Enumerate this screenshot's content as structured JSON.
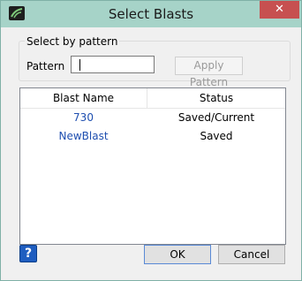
{
  "window": {
    "title": "Select Blasts",
    "close_glyph": "✕"
  },
  "pattern_group": {
    "legend": "Select by pattern",
    "label": "Pattern",
    "input_value": "",
    "apply_label": "Apply Pattern"
  },
  "table": {
    "columns": [
      "Blast Name",
      "Status"
    ],
    "rows": [
      {
        "name": "730",
        "status": "Saved/Current"
      },
      {
        "name": "NewBlast",
        "status": "Saved"
      }
    ]
  },
  "footer": {
    "help_glyph": "?",
    "ok_label": "OK",
    "cancel_label": "Cancel"
  },
  "colors": {
    "titlebar": "#a6d3c8",
    "close": "#c75050",
    "link_text": "#1f4fb0"
  },
  "icons": {
    "app": "app-logo-icon",
    "close": "close-icon",
    "help": "help-icon"
  }
}
